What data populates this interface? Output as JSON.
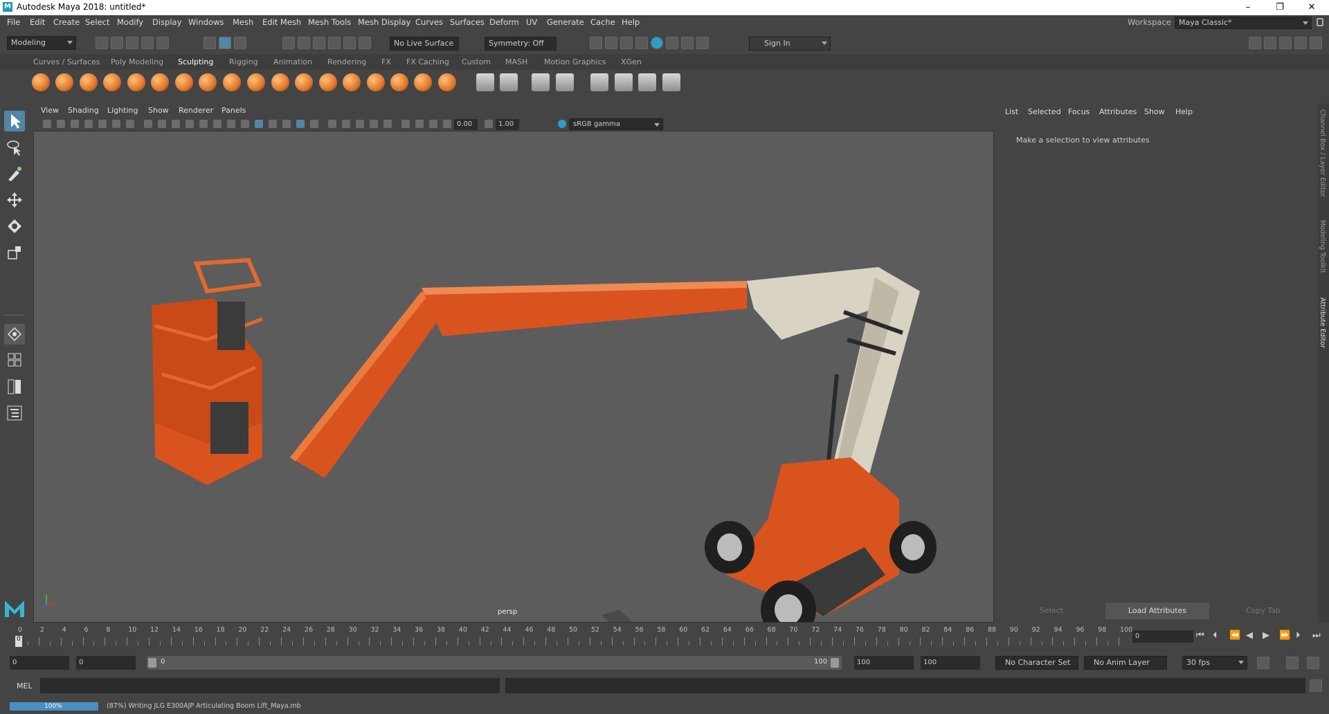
{
  "window": {
    "title": "Autodesk Maya 2018: untitled*",
    "logo_letter": "M",
    "minimize": "–",
    "maximize": "❐",
    "close": "✕"
  },
  "menubar": [
    "File",
    "Edit",
    "Create",
    "Select",
    "Modify",
    "Display",
    "Windows",
    "Mesh",
    "Edit Mesh",
    "Mesh Tools",
    "Mesh Display",
    "Curves",
    "Surfaces",
    "Deform",
    "UV",
    "Generate",
    "Cache",
    "Help"
  ],
  "workspace": {
    "label": "Workspace :",
    "value": "Maya Classic*"
  },
  "statusline": {
    "menuset": "Modeling",
    "live_surface": "No Live Surface",
    "symmetry": "Symmetry: Off",
    "sign_in": "Sign In"
  },
  "shelf_tabs": [
    "Curves / Surfaces",
    "Poly Modeling",
    "Sculpting",
    "Rigging",
    "Animation",
    "Rendering",
    "FX",
    "FX Caching",
    "Custom",
    "MASH",
    "Motion Graphics",
    "XGen"
  ],
  "active_shelf": "Sculpting",
  "panel_menu": [
    "View",
    "Shading",
    "Lighting",
    "Show",
    "Renderer",
    "Panels"
  ],
  "panel_toolbar": {
    "exposure": "0.00",
    "gamma": "1.00",
    "color_space": "sRGB gamma"
  },
  "viewport": {
    "camera_label": "persp"
  },
  "attribute_editor": {
    "menu": [
      "List",
      "Selected",
      "Focus",
      "Attributes",
      "Show",
      "Help"
    ],
    "message": "Make a selection to view attributes",
    "buttons": {
      "select": "Select",
      "load": "Load Attributes",
      "copy": "Copy Tab"
    }
  },
  "side_tabs": [
    "Channel Box / Layer Editor",
    "Modeling Toolkit",
    "Attribute Editor"
  ],
  "timeline": {
    "ticks": [
      "0",
      "2",
      "4",
      "6",
      "8",
      "10",
      "12",
      "14",
      "16",
      "18",
      "20",
      "22",
      "24",
      "26",
      "28",
      "30",
      "32",
      "34",
      "36",
      "38",
      "40",
      "42",
      "44",
      "46",
      "48",
      "50",
      "52",
      "54",
      "56",
      "58",
      "60",
      "62",
      "64",
      "66",
      "68",
      "70",
      "72",
      "74",
      "76",
      "78",
      "80",
      "82",
      "84",
      "86",
      "88",
      "90",
      "92",
      "94",
      "96",
      "98",
      "100"
    ],
    "current_frame_marker": "0",
    "current_frame_field": "0"
  },
  "range": {
    "start": "0",
    "playback_start": "0",
    "slider_start": "0",
    "slider_end": "100",
    "playback_end": "100",
    "end": "100",
    "character_set": "No Character Set",
    "anim_layer": "No Anim Layer",
    "fps": "30 fps"
  },
  "command_line": {
    "language": "MEL"
  },
  "help_line": {
    "progress_label": "100%",
    "progress": 1.0,
    "message": "(87%) Writing JLG E300AJP Articulating Boom Lift_Maya.mb"
  },
  "colors": {
    "accent": "#5285a6",
    "boom_orange": "#d9531e",
    "boom_cream": "#d9d3c3"
  }
}
